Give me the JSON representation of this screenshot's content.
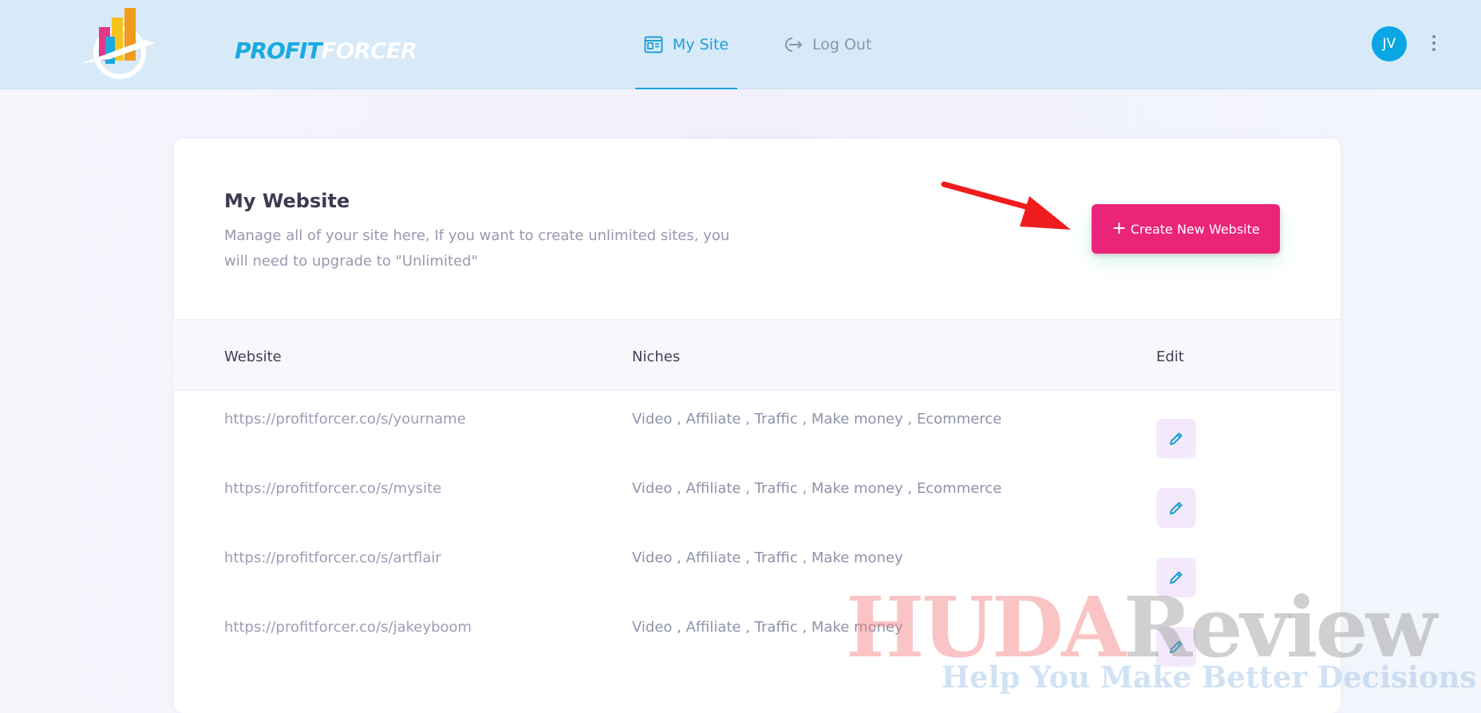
{
  "header": {
    "logo": {
      "part1": "PROFIT",
      "part2": "FORCER"
    },
    "nav": [
      {
        "label": "My Site",
        "icon": "newspaper-icon",
        "active": true
      },
      {
        "label": "Log Out",
        "icon": "logout-icon",
        "active": false
      }
    ],
    "avatar_initials": "JV",
    "menu_icon": "kebab-menu-icon"
  },
  "card": {
    "title": "My Website",
    "description": "Manage all of your site here, If you want to create unlimited sites, you will need to upgrade to \"Unlimited\"",
    "create_button": {
      "plus": "+",
      "label": "Create New Website"
    },
    "accent_color": "#ea2478",
    "table": {
      "headers": {
        "website": "Website",
        "niches": "Niches",
        "edit": "Edit"
      },
      "rows": [
        {
          "url": "https://profitforcer.co/s/yourname",
          "niches": "Video , Affiliate , Traffic , Make money , Ecommerce"
        },
        {
          "url": "https://profitforcer.co/s/mysite",
          "niches": "Video , Affiliate , Traffic , Make money , Ecommerce"
        },
        {
          "url": "https://profitforcer.co/s/artflair",
          "niches": "Video , Affiliate , Traffic , Make money"
        },
        {
          "url": "https://profitforcer.co/s/jakeyboom",
          "niches": "Video , Affiliate , Traffic , Make money"
        }
      ]
    }
  },
  "watermark": {
    "part1": "HUDA",
    "part2": "Review",
    "tagline": "Help You Make Better Decisions"
  }
}
